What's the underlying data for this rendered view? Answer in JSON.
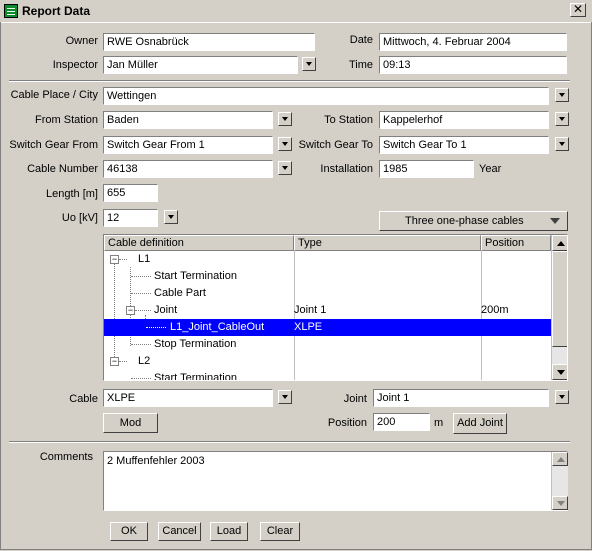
{
  "window": {
    "title": "Report Data",
    "close_glyph": "✕"
  },
  "header": {
    "owner_label": "Owner",
    "owner_value": "RWE Osnabrück",
    "date_label": "Date",
    "date_value": "Mittwoch, 4. Februar 2004",
    "inspector_label": "Inspector",
    "inspector_value": "Jan Müller",
    "time_label": "Time",
    "time_value": "09:13"
  },
  "cable": {
    "place_label": "Cable Place / City",
    "place_value": "Wettingen",
    "from_station_label": "From Station",
    "from_station_value": "Baden",
    "to_station_label": "To Station",
    "to_station_value": "Kappelerhof",
    "switch_from_label": "Switch Gear From",
    "switch_from_value": "Switch Gear From 1",
    "switch_to_label": "Switch Gear To",
    "switch_to_value": "Switch Gear To 1",
    "number_label": "Cable Number",
    "number_value": "46138",
    "installation_label": "Installation",
    "installation_value": "1985",
    "year_label": "Year",
    "length_label": "Length [m]",
    "length_value": "655",
    "uo_label": "Uo [kV]",
    "uo_value": "12",
    "phase_mode": "Three one-phase cables"
  },
  "tree": {
    "columns": [
      "Cable definition",
      "Type",
      "Position"
    ],
    "rows": [
      {
        "def": "L1",
        "type": "",
        "position": ""
      },
      {
        "def": "Start Termination",
        "type": "",
        "position": ""
      },
      {
        "def": "Cable Part",
        "type": "",
        "position": ""
      },
      {
        "def": "Joint",
        "type": "Joint 1",
        "position": "200m"
      },
      {
        "def": "L1_Joint_CableOut",
        "type": "XLPE",
        "position": ""
      },
      {
        "def": "Stop Termination",
        "type": "",
        "position": ""
      },
      {
        "def": "L2",
        "type": "",
        "position": ""
      },
      {
        "def": "Start Termination",
        "type": "",
        "position": ""
      }
    ]
  },
  "detail": {
    "cable_label": "Cable",
    "cable_value": "XLPE",
    "joint_label": "Joint",
    "joint_value": "Joint 1",
    "mod_button": "Mod",
    "position_label": "Position",
    "position_value": "200",
    "position_unit": "m",
    "add_joint_button": "Add Joint"
  },
  "comments": {
    "label": "Comments",
    "value": "2 Muffenfehler 2003"
  },
  "buttons": {
    "ok": "OK",
    "cancel": "Cancel",
    "load": "Load",
    "clear": "Clear"
  },
  "colors": {
    "titlebar": "#d4d0c8",
    "selection": "#0000ff",
    "face": "#d4d0c8"
  }
}
